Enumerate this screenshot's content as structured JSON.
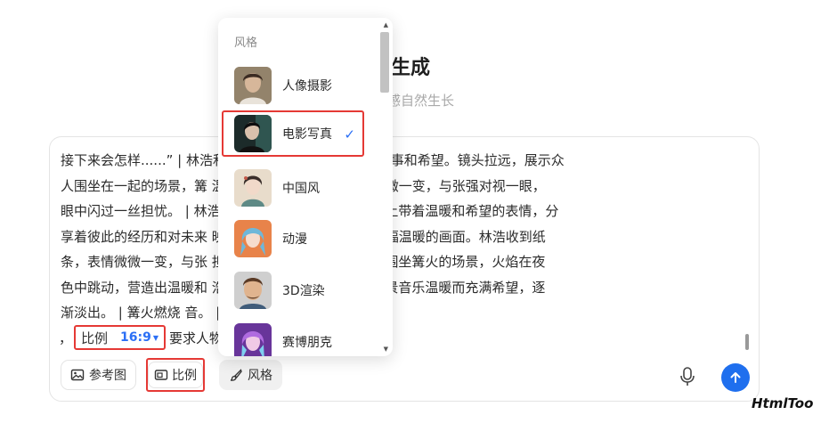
{
  "page": {
    "title": "像生成",
    "subtitle": "，让灵感自然生长"
  },
  "prompt": {
    "lines": [
      "接下来会怎样......” | 林浩和                    坐在篝火旁，分享彼此的故事和希望。镜头拉远，展示众",
      "人围坐在一起的场景，篝                         温暖。林浩收到纸条，表情微微一变，与张强对视一眼，",
      "眼中闪过一丝担忧。 | 林浩                        存者们围坐在一起。大家脸上带着温暖和希望的表情，分",
      "享着彼此的经历和对未来                          映照在每个人的脸上，形成一幅温暖的画面。林浩收到纸",
      "条，表情微微一变，与张                          担忧。 | 镜头拉远，展示众人围坐篝火的场景，火焰在夜",
      "色中跳动，营造出温暖和                          浩和张强担忧的表情上。 | 背景音乐温暖而充满希望，逐",
      "渐淡出。          | 篝火燃烧                          音。          |"
    ],
    "ratio_prefix": "，",
    "ratio_label": "比例",
    "ratio_value": "16:9",
    "ratio_suffix": "要求人物"
  },
  "toolbar": {
    "reference_label": "参考图",
    "ratio_label": "比例",
    "style_label": "风格"
  },
  "dropdown": {
    "heading": "风格",
    "selected": "电影写真",
    "items": [
      {
        "label": "人像摄影"
      },
      {
        "label": "电影写真"
      },
      {
        "label": "中国风"
      },
      {
        "label": "动漫"
      },
      {
        "label": "3D渲染"
      },
      {
        "label": "赛博朋克"
      }
    ]
  },
  "watermark": "HtmlToo",
  "colors": {
    "accent": "#2b6ff5",
    "send_button": "#1f6fee",
    "highlight_border": "#e53935"
  }
}
